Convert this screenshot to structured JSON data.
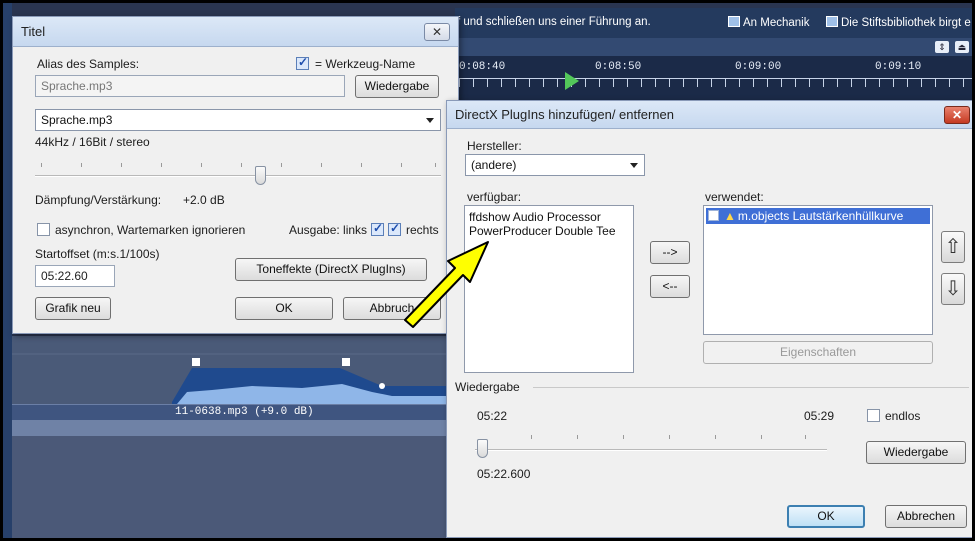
{
  "background": {
    "banner_left": "f und schließen uns einer Führung an.",
    "banner_mid": "An Mechanik",
    "banner_right": "Die Stiftsbibliothek birgt e",
    "timecodes": [
      "0:08:40",
      "0:08:50",
      "0:09:00",
      "0:09:10"
    ],
    "clip_name": "11-0638.mp3 (+9.0 dB)"
  },
  "titel_dialog": {
    "title": "Titel",
    "close": "✕",
    "alias_label": "Alias des Samples:",
    "alias_value": "Sprache.mp3",
    "tool_name_label": "= Werkzeug-Name",
    "tool_name_checked": true,
    "playback_button": "Wiedergabe",
    "file_select": "Sprache.mp3",
    "format_info": "44kHz / 16Bit / stereo",
    "damping_label": "Dämpfung/Verstärkung:",
    "damping_value": "+2.0 dB",
    "async_label": "asynchron, Wartemarken ignorieren",
    "async_checked": false,
    "output_label": "Ausgabe: links",
    "output_right": "rechts",
    "left_checked": true,
    "right_checked": true,
    "start_offset_label": "Startoffset (m:s.1/100s)",
    "start_offset_value": "05:22.60",
    "tone_effects_button": "Toneffekte (DirectX PlugIns)",
    "new_graphic_button": "Grafik neu",
    "ok_button": "OK",
    "cancel_button": "Abbruch"
  },
  "directx_dialog": {
    "title": "DirectX PlugIns hinzufügen/ entfernen",
    "close": "✕",
    "manufacturer_label": "Hersteller:",
    "manufacturer_value": "(andere)",
    "available_label": "verfügbar:",
    "available_items": [
      "ffdshow Audio Processor",
      "PowerProducer Double Tee"
    ],
    "used_label": "verwendet:",
    "used_items": [
      "m.objects Lautstärkenhüllkurve"
    ],
    "add_button": "-->",
    "remove_button": "<--",
    "properties_button": "Eigenschaften",
    "playback_group": "Wiedergabe",
    "time_start": "05:22",
    "time_end": "05:29",
    "endless_label": "endlos",
    "endless_checked": false,
    "current_time": "05:22.600",
    "playback_button": "Wiedergabe",
    "ok_button": "OK",
    "cancel_button": "Abbrechen",
    "up_arrow": "⇧",
    "down_arrow": "⇩"
  },
  "colors": {
    "accent_arrow": "#ffff00",
    "selection": "#3f6fd6",
    "wave": "#1f56b4"
  }
}
